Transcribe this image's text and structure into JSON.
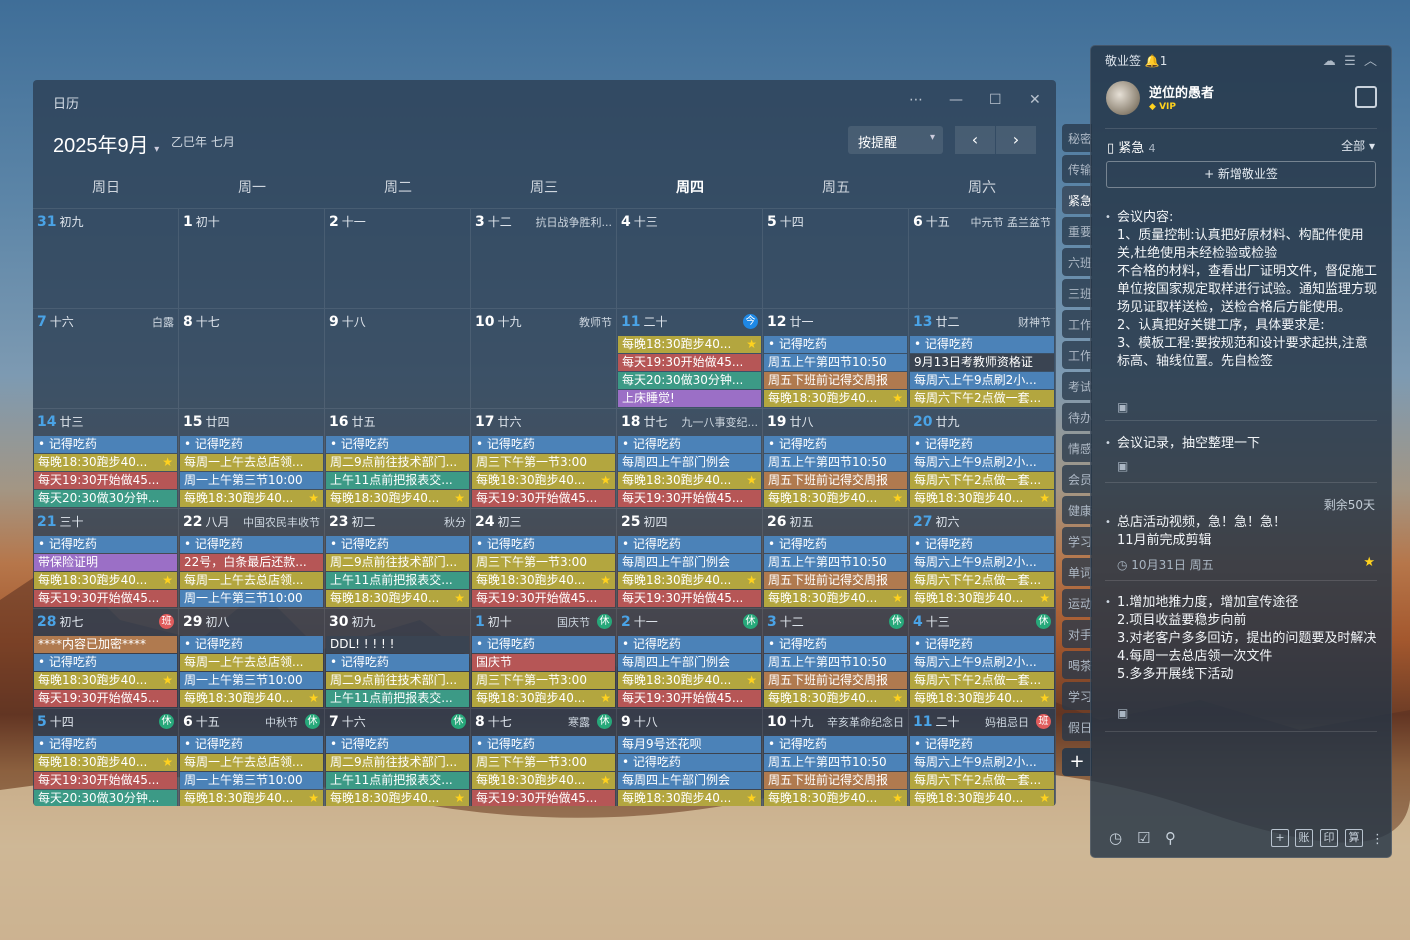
{
  "calendar": {
    "window_title": "日历",
    "window_buttons": [
      "⋯",
      "—",
      "☐",
      "✕"
    ],
    "month_label": "2025年9月",
    "lunar_label": "乙巳年 七月",
    "mode": "按提醒",
    "prev": "‹",
    "next": "›",
    "weekdays": [
      "周日",
      "周一",
      "周二",
      "周三",
      "周四",
      "周五",
      "周六"
    ],
    "weeks": [
      [
        {
          "d": "31",
          "l": "初九",
          "dim": true,
          "events": []
        },
        {
          "d": "1",
          "l": "初十",
          "events": []
        },
        {
          "d": "2",
          "l": "十一",
          "events": []
        },
        {
          "d": "3",
          "l": "十二",
          "f": "抗日战争胜利...",
          "events": []
        },
        {
          "d": "4",
          "l": "十三",
          "events": []
        },
        {
          "d": "5",
          "l": "十四",
          "events": []
        },
        {
          "d": "6",
          "l": "十五",
          "f": "中元节 孟兰盆节",
          "events": []
        }
      ],
      [
        {
          "d": "7",
          "l": "十六",
          "f": "白露",
          "dimn": true,
          "events": []
        },
        {
          "d": "8",
          "l": "十七",
          "events": []
        },
        {
          "d": "9",
          "l": "十八",
          "events": []
        },
        {
          "d": "10",
          "l": "十九",
          "f": "教师节",
          "events": []
        },
        {
          "d": "11",
          "l": "二十",
          "today": true,
          "badge": "今",
          "events": [
            {
              "t": "每晚18:30跑步40...",
              "c": "y",
              "star": true
            },
            {
              "t": "每天19:30开始做45...",
              "c": "r"
            },
            {
              "t": "每天20:30做30分钟...",
              "c": "g"
            },
            {
              "t": "上床睡觉!",
              "c": "p"
            }
          ]
        },
        {
          "d": "12",
          "l": "廿一",
          "events": [
            {
              "t": "• 记得吃药",
              "c": "b"
            },
            {
              "t": "周五上午第四节10:50",
              "c": "b"
            },
            {
              "t": "周五下班前记得交周报",
              "c": "o"
            },
            {
              "t": "每晚18:30跑步40...",
              "c": "y",
              "star": true
            }
          ]
        },
        {
          "d": "13",
          "l": "廿二",
          "f": "财神节",
          "dimn": true,
          "events": [
            {
              "t": "• 记得吃药",
              "c": "b"
            },
            {
              "t": "9月13日考教师资格证",
              "c": "d"
            },
            {
              "t": "每周六上午9点刷2小...",
              "c": "b"
            },
            {
              "t": "每周六下午2点做一套...",
              "c": "y"
            }
          ]
        }
      ],
      [
        {
          "d": "14",
          "l": "廿三",
          "dimn": true,
          "events": [
            {
              "t": "• 记得吃药",
              "c": "b"
            },
            {
              "t": "每晚18:30跑步40...",
              "c": "y",
              "star": true
            },
            {
              "t": "每天19:30开始做45...",
              "c": "r"
            },
            {
              "t": "每天20:30做30分钟...",
              "c": "g"
            }
          ]
        },
        {
          "d": "15",
          "l": "廿四",
          "events": [
            {
              "t": "• 记得吃药",
              "c": "b"
            },
            {
              "t": "每周一上午去总店领...",
              "c": "y"
            },
            {
              "t": "周一上午第三节10:00",
              "c": "b"
            },
            {
              "t": "每晚18:30跑步40...",
              "c": "y",
              "star": true
            }
          ]
        },
        {
          "d": "16",
          "l": "廿五",
          "events": [
            {
              "t": "• 记得吃药",
              "c": "b"
            },
            {
              "t": "周二9点前往技术部门...",
              "c": "y"
            },
            {
              "t": "上午11点前把报表交...",
              "c": "g"
            },
            {
              "t": "每晚18:30跑步40...",
              "c": "y",
              "star": true
            }
          ]
        },
        {
          "d": "17",
          "l": "廿六",
          "events": [
            {
              "t": "• 记得吃药",
              "c": "b"
            },
            {
              "t": "周三下午第一节3:00",
              "c": "y"
            },
            {
              "t": "每晚18:30跑步40...",
              "c": "y",
              "star": true
            },
            {
              "t": "每天19:30开始做45...",
              "c": "r"
            }
          ]
        },
        {
          "d": "18",
          "l": "廿七",
          "f": "九一八事变纪...",
          "events": [
            {
              "t": "• 记得吃药",
              "c": "b"
            },
            {
              "t": "每周四上午部门例会",
              "c": "b"
            },
            {
              "t": "每晚18:30跑步40...",
              "c": "y",
              "star": true
            },
            {
              "t": "每天19:30开始做45...",
              "c": "r"
            }
          ]
        },
        {
          "d": "19",
          "l": "廿八",
          "events": [
            {
              "t": "• 记得吃药",
              "c": "b"
            },
            {
              "t": "周五上午第四节10:50",
              "c": "b"
            },
            {
              "t": "周五下班前记得交周报",
              "c": "o"
            },
            {
              "t": "每晚18:30跑步40...",
              "c": "y",
              "star": true
            }
          ]
        },
        {
          "d": "20",
          "l": "廿九",
          "dimn": true,
          "events": [
            {
              "t": "• 记得吃药",
              "c": "b"
            },
            {
              "t": "每周六上午9点刷2小...",
              "c": "b"
            },
            {
              "t": "每周六下午2点做一套...",
              "c": "y"
            },
            {
              "t": "每晚18:30跑步40...",
              "c": "y",
              "star": true
            }
          ]
        }
      ],
      [
        {
          "d": "21",
          "l": "三十",
          "dimn": true,
          "events": [
            {
              "t": "• 记得吃药",
              "c": "b"
            },
            {
              "t": "带保险证明",
              "c": "p"
            },
            {
              "t": "每晚18:30跑步40...",
              "c": "y",
              "star": true
            },
            {
              "t": "每天19:30开始做45...",
              "c": "r"
            }
          ]
        },
        {
          "d": "22",
          "l": "八月",
          "f": "中国农民丰收节",
          "events": [
            {
              "t": "• 记得吃药",
              "c": "b"
            },
            {
              "t": "22号，白条最后还款...",
              "c": "r"
            },
            {
              "t": "每周一上午去总店领...",
              "c": "y"
            },
            {
              "t": "周一上午第三节10:00",
              "c": "b"
            }
          ]
        },
        {
          "d": "23",
          "l": "初二",
          "f": "秋分",
          "events": [
            {
              "t": "• 记得吃药",
              "c": "b"
            },
            {
              "t": "周二9点前往技术部门...",
              "c": "y"
            },
            {
              "t": "上午11点前把报表交...",
              "c": "g"
            },
            {
              "t": "每晚18:30跑步40...",
              "c": "y",
              "star": true
            }
          ]
        },
        {
          "d": "24",
          "l": "初三",
          "events": [
            {
              "t": "• 记得吃药",
              "c": "b"
            },
            {
              "t": "周三下午第一节3:00",
              "c": "y"
            },
            {
              "t": "每晚18:30跑步40...",
              "c": "y",
              "star": true
            },
            {
              "t": "每天19:30开始做45...",
              "c": "r"
            }
          ]
        },
        {
          "d": "25",
          "l": "初四",
          "events": [
            {
              "t": "• 记得吃药",
              "c": "b"
            },
            {
              "t": "每周四上午部门例会",
              "c": "b"
            },
            {
              "t": "每晚18:30跑步40...",
              "c": "y",
              "star": true
            },
            {
              "t": "每天19:30开始做45...",
              "c": "r"
            }
          ]
        },
        {
          "d": "26",
          "l": "初五",
          "events": [
            {
              "t": "• 记得吃药",
              "c": "b"
            },
            {
              "t": "周五上午第四节10:50",
              "c": "b"
            },
            {
              "t": "周五下班前记得交周报",
              "c": "o"
            },
            {
              "t": "每晚18:30跑步40...",
              "c": "y",
              "star": true
            }
          ]
        },
        {
          "d": "27",
          "l": "初六",
          "dimn": true,
          "events": [
            {
              "t": "• 记得吃药",
              "c": "b"
            },
            {
              "t": "每周六上午9点刷2小...",
              "c": "b"
            },
            {
              "t": "每周六下午2点做一套...",
              "c": "y"
            },
            {
              "t": "每晚18:30跑步40...",
              "c": "y",
              "star": true
            }
          ]
        }
      ],
      [
        {
          "d": "28",
          "l": "初七",
          "dimn": true,
          "badge": "班",
          "bc": "#e05c5c",
          "events": [
            {
              "t": "****内容已加密****",
              "c": "o"
            },
            {
              "t": "• 记得吃药",
              "c": "b"
            },
            {
              "t": "每晚18:30跑步40...",
              "c": "y",
              "star": true
            },
            {
              "t": "每天19:30开始做45...",
              "c": "r"
            }
          ]
        },
        {
          "d": "29",
          "l": "初八",
          "events": [
            {
              "t": "• 记得吃药",
              "c": "b"
            },
            {
              "t": "每周一上午去总店领...",
              "c": "y"
            },
            {
              "t": "周一上午第三节10:00",
              "c": "b"
            },
            {
              "t": "每晚18:30跑步40...",
              "c": "y",
              "star": true
            }
          ]
        },
        {
          "d": "30",
          "l": "初九",
          "events": [
            {
              "t": "DDL! ! ! ! !",
              "c": "d"
            },
            {
              "t": "• 记得吃药",
              "c": "b"
            },
            {
              "t": "周二9点前往技术部门...",
              "c": "y"
            },
            {
              "t": "上午11点前把报表交...",
              "c": "g"
            }
          ]
        },
        {
          "d": "1",
          "l": "初十",
          "f": "国庆节",
          "dim": true,
          "badge": "休",
          "bc": "#27a87a",
          "events": [
            {
              "t": "• 记得吃药",
              "c": "b"
            },
            {
              "t": "国庆节",
              "c": "r"
            },
            {
              "t": "周三下午第一节3:00",
              "c": "y"
            },
            {
              "t": "每晚18:30跑步40...",
              "c": "y",
              "star": true
            }
          ]
        },
        {
          "d": "2",
          "l": "十一",
          "dim": true,
          "badge": "休",
          "bc": "#27a87a",
          "events": [
            {
              "t": "• 记得吃药",
              "c": "b"
            },
            {
              "t": "每周四上午部门例会",
              "c": "b"
            },
            {
              "t": "每晚18:30跑步40...",
              "c": "y",
              "star": true
            },
            {
              "t": "每天19:30开始做45...",
              "c": "r"
            }
          ]
        },
        {
          "d": "3",
          "l": "十二",
          "dim": true,
          "badge": "休",
          "bc": "#27a87a",
          "events": [
            {
              "t": "• 记得吃药",
              "c": "b"
            },
            {
              "t": "周五上午第四节10:50",
              "c": "b"
            },
            {
              "t": "周五下班前记得交周报",
              "c": "o"
            },
            {
              "t": "每晚18:30跑步40...",
              "c": "y",
              "star": true
            }
          ]
        },
        {
          "d": "4",
          "l": "十三",
          "dim": true,
          "badge": "休",
          "bc": "#27a87a",
          "events": [
            {
              "t": "• 记得吃药",
              "c": "b"
            },
            {
              "t": "每周六上午9点刷2小...",
              "c": "b"
            },
            {
              "t": "每周六下午2点做一套...",
              "c": "y"
            },
            {
              "t": "每晚18:30跑步40...",
              "c": "y",
              "star": true
            }
          ]
        }
      ],
      [
        {
          "d": "5",
          "l": "十四",
          "dim": true,
          "badge": "休",
          "bc": "#27a87a",
          "events": [
            {
              "t": "• 记得吃药",
              "c": "b"
            },
            {
              "t": "每晚18:30跑步40...",
              "c": "y",
              "star": true
            },
            {
              "t": "每天19:30开始做45...",
              "c": "r"
            },
            {
              "t": "每天20:30做30分钟...",
              "c": "g"
            }
          ]
        },
        {
          "d": "6",
          "l": "十五",
          "f": "中秋节",
          "badge": "休",
          "bc": "#27a87a",
          "events": [
            {
              "t": "• 记得吃药",
              "c": "b"
            },
            {
              "t": "每周一上午去总店领...",
              "c": "y"
            },
            {
              "t": "周一上午第三节10:00",
              "c": "b"
            },
            {
              "t": "每晚18:30跑步40...",
              "c": "y",
              "star": true
            }
          ]
        },
        {
          "d": "7",
          "l": "十六",
          "badge": "休",
          "bc": "#27a87a",
          "events": [
            {
              "t": "• 记得吃药",
              "c": "b"
            },
            {
              "t": "周二9点前往技术部门...",
              "c": "y"
            },
            {
              "t": "上午11点前把报表交...",
              "c": "g"
            },
            {
              "t": "每晚18:30跑步40...",
              "c": "y",
              "star": true
            }
          ]
        },
        {
          "d": "8",
          "l": "十七",
          "f": "寒露",
          "badge": "休",
          "bc": "#27a87a",
          "events": [
            {
              "t": "• 记得吃药",
              "c": "b"
            },
            {
              "t": "周三下午第一节3:00",
              "c": "y"
            },
            {
              "t": "每晚18:30跑步40...",
              "c": "y",
              "star": true
            },
            {
              "t": "每天19:30开始做45...",
              "c": "r"
            }
          ]
        },
        {
          "d": "9",
          "l": "十八",
          "events": [
            {
              "t": "每月9号还花呗",
              "c": "b"
            },
            {
              "t": "• 记得吃药",
              "c": "b"
            },
            {
              "t": "每周四上午部门例会",
              "c": "b"
            },
            {
              "t": "每晚18:30跑步40...",
              "c": "y",
              "star": true
            }
          ]
        },
        {
          "d": "10",
          "l": "十九",
          "f": "辛亥革命纪念日",
          "events": [
            {
              "t": "• 记得吃药",
              "c": "b"
            },
            {
              "t": "周五上午第四节10:50",
              "c": "b"
            },
            {
              "t": "周五下班前记得交周报",
              "c": "o"
            },
            {
              "t": "每晚18:30跑步40...",
              "c": "y",
              "star": true
            }
          ]
        },
        {
          "d": "11",
          "l": "二十",
          "f": "妈祖忌日",
          "dim": true,
          "badge": "班",
          "bc": "#e05c5c",
          "events": [
            {
              "t": "• 记得吃药",
              "c": "b"
            },
            {
              "t": "每周六上午9点刷2小...",
              "c": "b"
            },
            {
              "t": "每周六下午2点做一套...",
              "c": "y"
            },
            {
              "t": "每晚18:30跑步40...",
              "c": "y",
              "star": true
            }
          ]
        }
      ]
    ]
  },
  "colors": {
    "b": "#4b82b8",
    "y": "#b3a63f",
    "r": "#b65656",
    "g": "#3c9a86",
    "p": "#9b6fc6",
    "o": "#b07a4f",
    "d": "#3a4452"
  },
  "tabs": [
    "秘密",
    "传输",
    "紧急",
    "重要",
    "六班",
    "三班",
    "工作",
    "工作",
    "考试",
    "待办",
    "情感",
    "会员",
    "健康",
    "学习",
    "单词",
    "运动",
    "对手",
    "喝茶",
    "学习",
    "假日"
  ],
  "tab_add": "+",
  "sidebar": {
    "app_name": "敬业签",
    "notif_count": "1",
    "user": "逆位的愚者",
    "vip": "VIP",
    "category": "紧急",
    "category_count": "4",
    "filter": "全部",
    "new_button": "+ 新增敬业签",
    "notes": [
      {
        "body": "会议内容:\n1、质量控制:认真把好原材料、构配件使用关,杜绝使用未经检验或检验\n不合格的材料，查看出厂证明文件，督促施工单位按国家规定取样进行试验。通知监理方现场见证取样送检，送检合格后方能使用。\n2、认真把好关键工序，具体要求是:\n3、模板工程:要按规范和设计要求起拱,注意标高、轴线位置。先自检签"
      },
      {
        "body": "会议记录，抽空整理一下"
      },
      {
        "body": "总店活动视频，急！急！急！\n11月前完成剪辑",
        "date": "10月31日 周五"
      },
      {
        "body": "1.增加地推力度，增加宣传途径\n2.项目收益要稳步向前\n3.对老客户多多回访，提出的问题要及时解决\n4.每周一去总店领一次文件\n5.多多开展线下活动"
      }
    ],
    "remaining": "剩余50天",
    "bottom": [
      "账",
      "印",
      "算"
    ]
  }
}
